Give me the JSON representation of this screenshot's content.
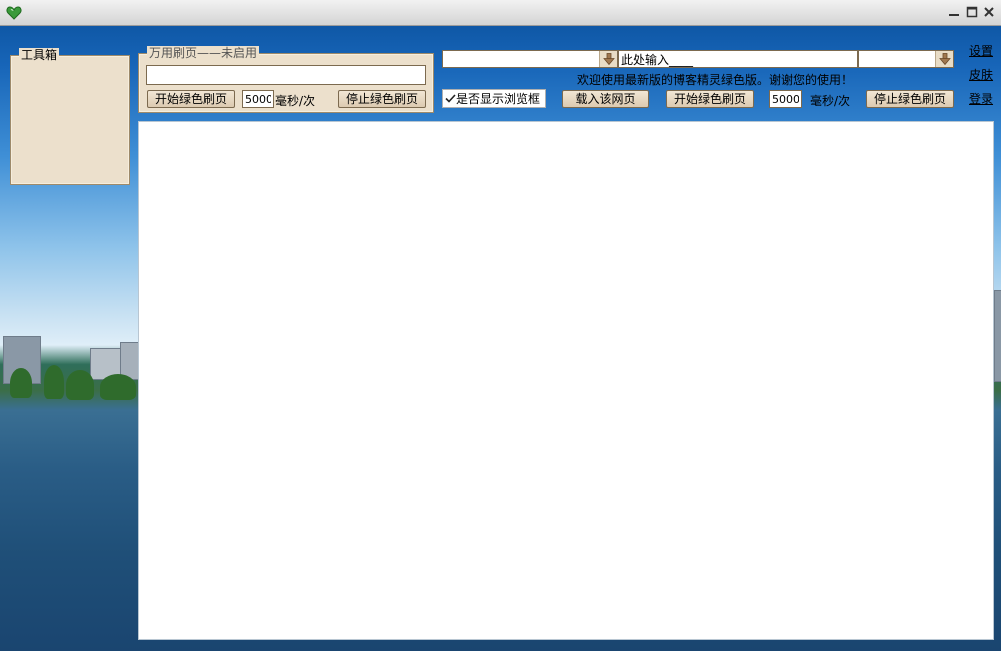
{
  "window": {
    "icon": "heart-icon",
    "controls": [
      "minimize-icon",
      "maximize-icon",
      "close-icon"
    ]
  },
  "toolbox": {
    "title": "工具箱"
  },
  "universal_refresh": {
    "title": "万用刷页——未启用",
    "url_value": "",
    "start_label": "开始绿色刷页",
    "interval_value": "5000",
    "unit_label": "毫秒/次",
    "stop_label": "停止绿色刷页"
  },
  "top_controls": {
    "combo_left_value": "",
    "input_value": "此处输入____",
    "combo_right_value": "",
    "welcome_text": "欢迎使用最新版的博客精灵绿色版。谢谢您的使用！",
    "show_browser_label": "是否显示浏览框",
    "show_browser_checked": true,
    "load_page_label": "载入该网页",
    "start_label": "开始绿色刷页",
    "interval_value": "5000",
    "unit_label": "毫秒/次",
    "stop_label": "停止绿色刷页"
  },
  "side_links": {
    "settings": "设置",
    "skin": "皮肤",
    "login": "登录"
  },
  "browser_view": {
    "content": ""
  },
  "colors": {
    "panel_bg": "#ece0cc",
    "panel_border": "#9d8a6b",
    "sky_top": "#0a4f9a"
  }
}
